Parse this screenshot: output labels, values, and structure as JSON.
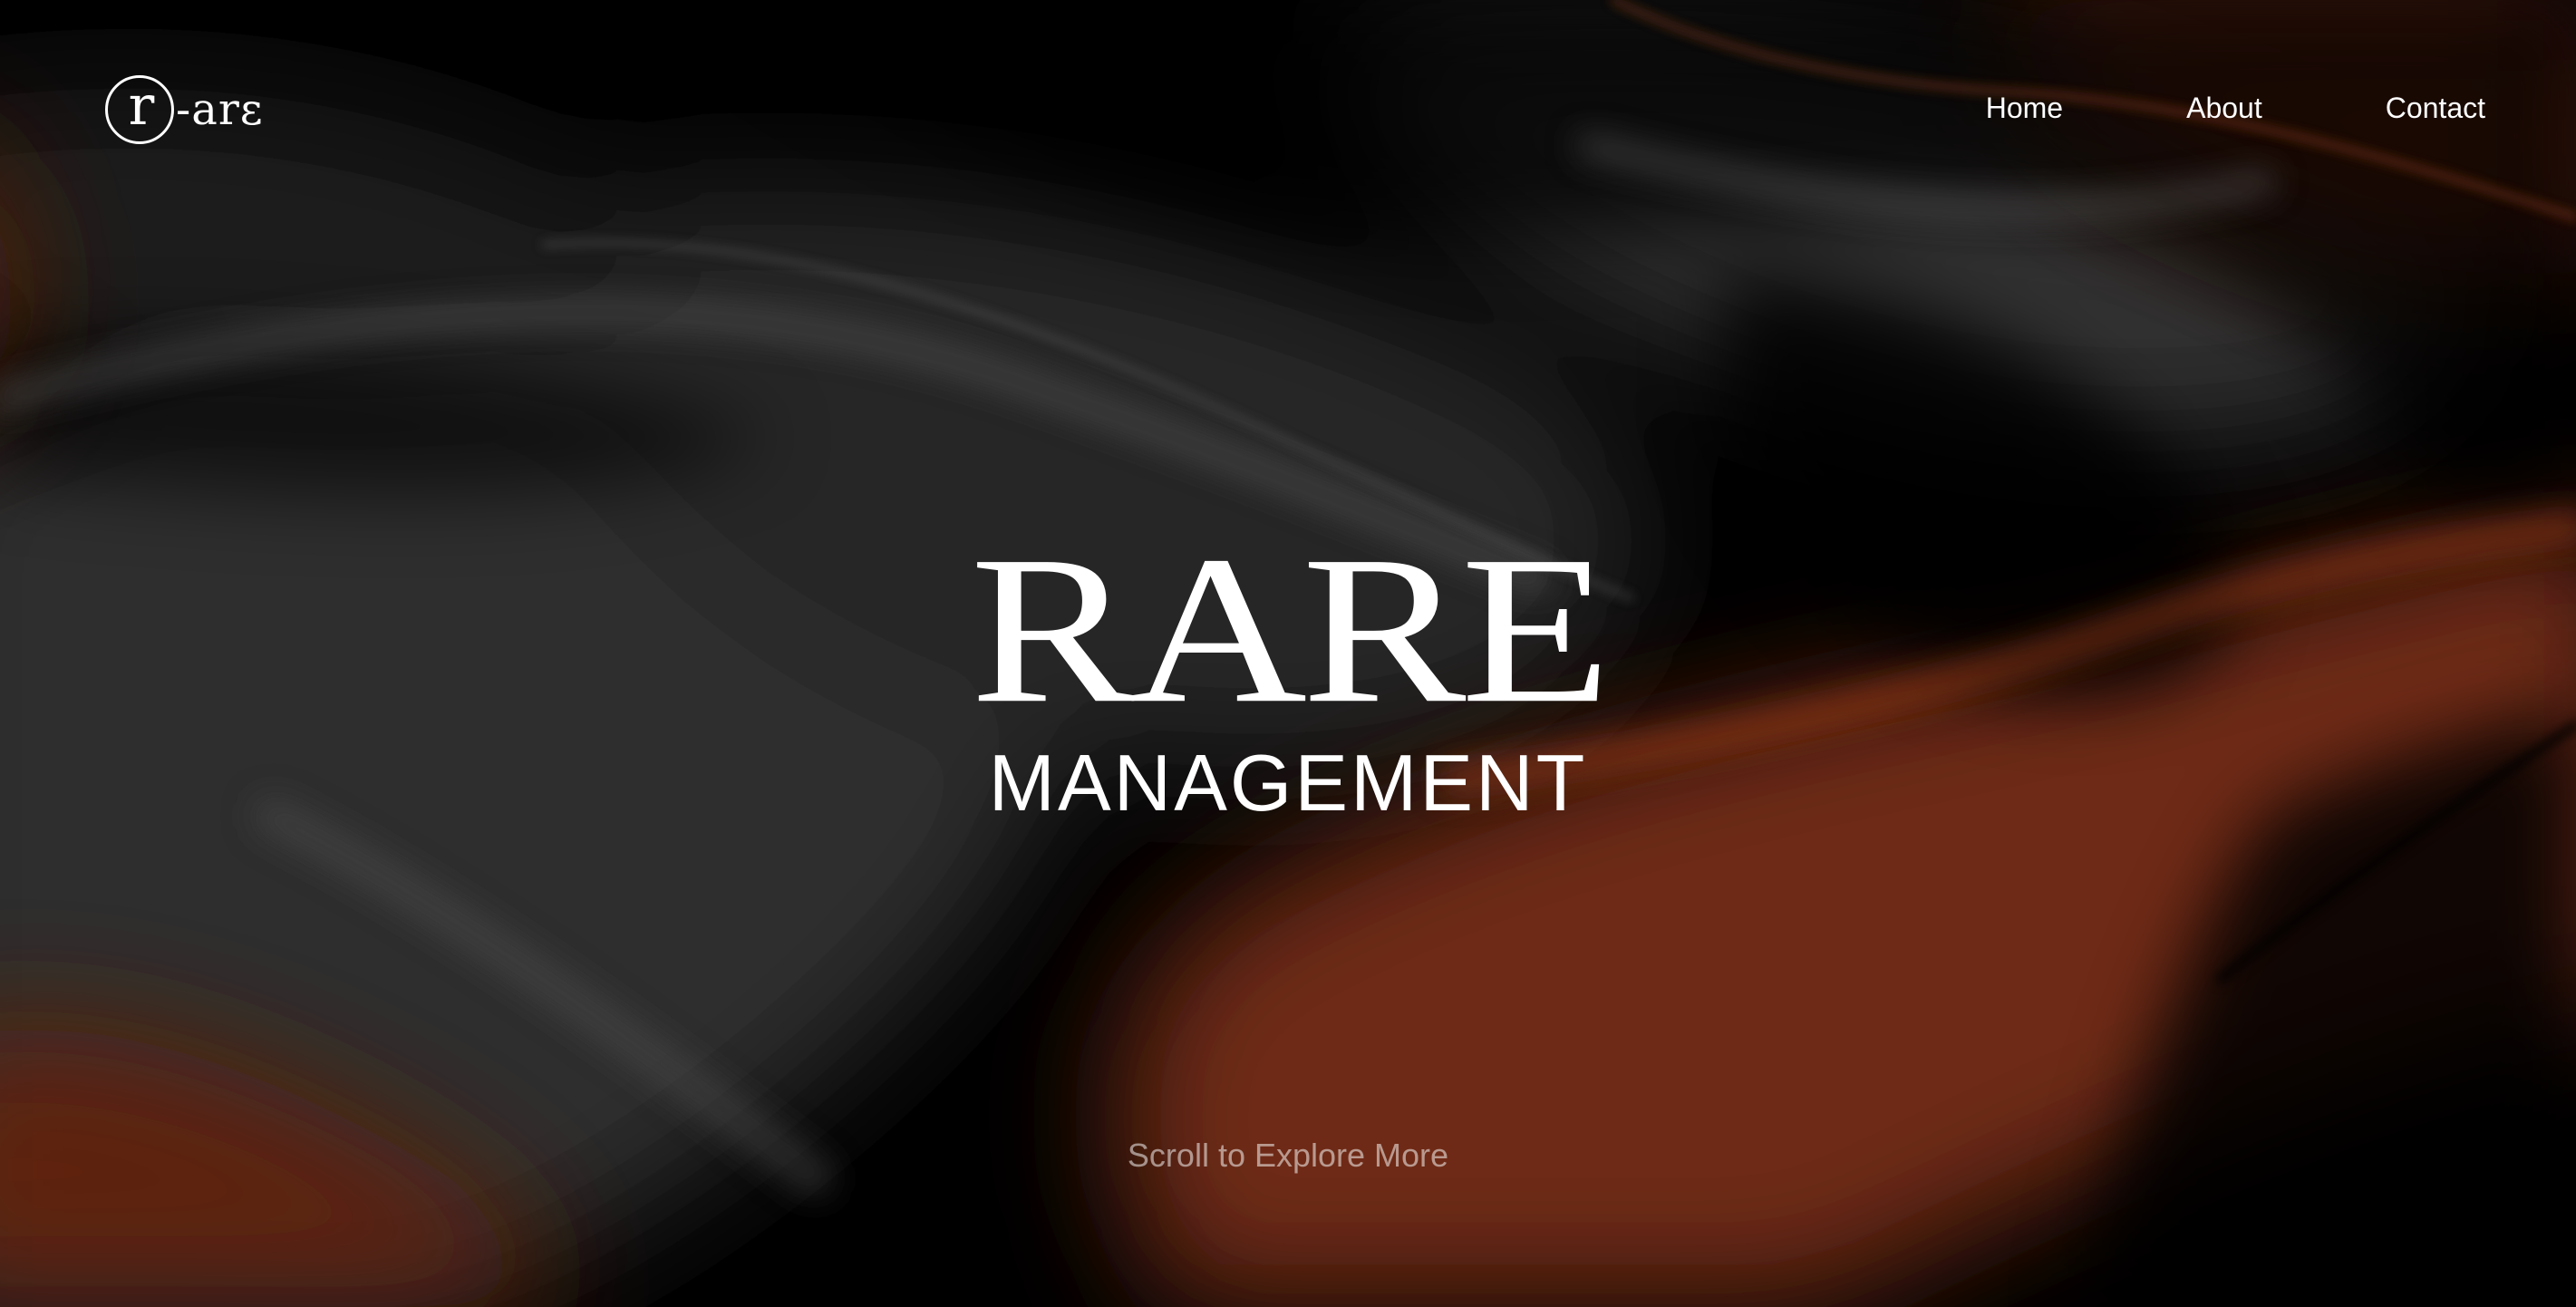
{
  "logo": {
    "initial": "r",
    "rest": "-arɛ"
  },
  "nav": {
    "items": [
      {
        "label": "Home"
      },
      {
        "label": "About"
      },
      {
        "label": "Contact"
      }
    ]
  },
  "hero": {
    "title": "RARE",
    "subtitle": "MANAGEMENT",
    "scroll_hint": "Scroll to Explore More"
  },
  "colors": {
    "background": "#000000",
    "silk_dark": "#3a3a3a",
    "silk_accent": "#7a2f15",
    "text": "#ffffff"
  }
}
